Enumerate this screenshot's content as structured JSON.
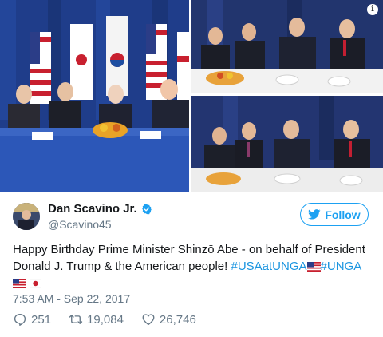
{
  "media": {
    "info_icon": "info-icon",
    "photos": [
      "photo-dinner-table-flags",
      "photo-abe-talking",
      "photo-abe-listening"
    ]
  },
  "author": {
    "display_name": "Dan Scavino Jr.",
    "handle": "@Scavino45",
    "verified": true,
    "verified_icon": "verified-badge-icon"
  },
  "follow_button": {
    "label": "Follow",
    "icon": "twitter-bird-icon"
  },
  "tweet": {
    "text_1": "Happy Birthday Prime Minister Shinzō Abe - on behalf of President Donald J. Trump & the American people! ",
    "hashtag_1": "#USAatUNGA",
    "hashtag_2": "#UNGA",
    "flags": [
      "us-flag",
      "us-flag",
      "japan-flag"
    ]
  },
  "timestamp": "7:53 AM - Sep 22, 2017",
  "actions": {
    "replies": "251",
    "retweets": "19,084",
    "likes": "26,746"
  },
  "colors": {
    "link": "#1b95e0",
    "brand": "#1da1f2",
    "muted": "#657786",
    "text": "#14171a"
  }
}
